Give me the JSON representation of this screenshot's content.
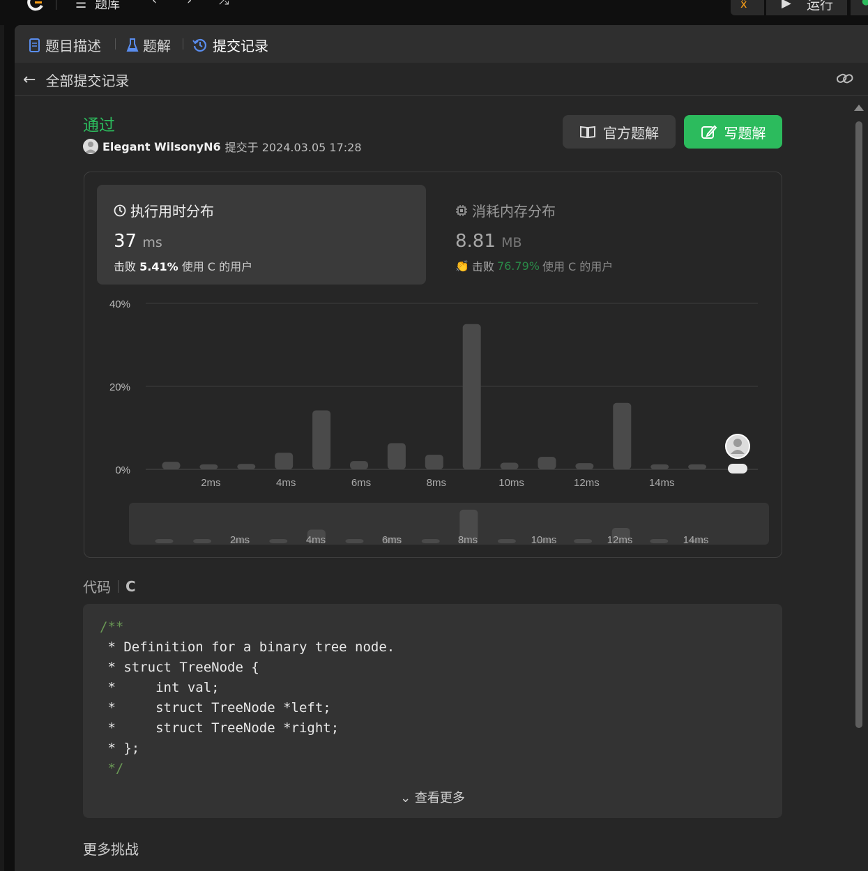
{
  "topbar": {
    "problems_label": "题库",
    "run_label": "运行"
  },
  "tabs": [
    {
      "label": "题目描述",
      "icon": "document-icon"
    },
    {
      "label": "题解",
      "icon": "flask-icon"
    },
    {
      "label": "提交记录",
      "icon": "history-icon"
    }
  ],
  "subbar": {
    "back_label": "全部提交记录",
    "link_icon": "link-icon"
  },
  "submission": {
    "status": "通过",
    "user": "Elegant WilsonyN6",
    "submitted_text": "提交于 2024.03.05 17:28"
  },
  "buttons": {
    "official_solution": "官方题解",
    "write_solution": "写题解"
  },
  "runtime": {
    "title": "执行用时分布",
    "value": "37",
    "unit": "ms",
    "beat_prefix": "击败",
    "beat_percent": "5.41%",
    "beat_suffix": "使用 C 的用户"
  },
  "memory": {
    "title": "消耗内存分布",
    "value": "8.81",
    "unit": "MB",
    "beat_prefix": "击败",
    "beat_percent": "76.79%",
    "beat_suffix": "使用 C 的用户"
  },
  "colors": {
    "accent_green": "#2cbb5d",
    "bar_gray": "#4a4a4a",
    "tab_active_blue": "#5a8dee"
  },
  "chart_data": {
    "type": "bar",
    "y_ticks": [
      "40%",
      "20%",
      "0%"
    ],
    "x_ticks": [
      "2ms",
      "4ms",
      "6ms",
      "8ms",
      "10ms",
      "12ms",
      "14ms"
    ],
    "ylim": [
      0,
      40
    ],
    "x": [
      1,
      2,
      3,
      4,
      5,
      6,
      7,
      8,
      9,
      10,
      11,
      12,
      13,
      14,
      15
    ],
    "values": [
      1.8,
      1.2,
      1.3,
      4.0,
      14.2,
      2.0,
      6.3,
      3.5,
      35.0,
      1.6,
      3.0,
      1.5,
      16.0,
      1.2,
      1.2
    ],
    "grid": true,
    "user_marker": "37ms",
    "navigator_ticks": [
      "2ms",
      "4ms",
      "6ms",
      "8ms",
      "10ms",
      "12ms",
      "14ms"
    ]
  },
  "code": {
    "label": "代码",
    "language": "C",
    "lines": [
      "/**",
      " * Definition for a binary tree node.",
      " * struct TreeNode {",
      " *     int val;",
      " *     struct TreeNode *left;",
      " *     struct TreeNode *right;",
      " * };",
      " */"
    ],
    "see_more": "查看更多"
  },
  "more_challenges": "更多挑战"
}
